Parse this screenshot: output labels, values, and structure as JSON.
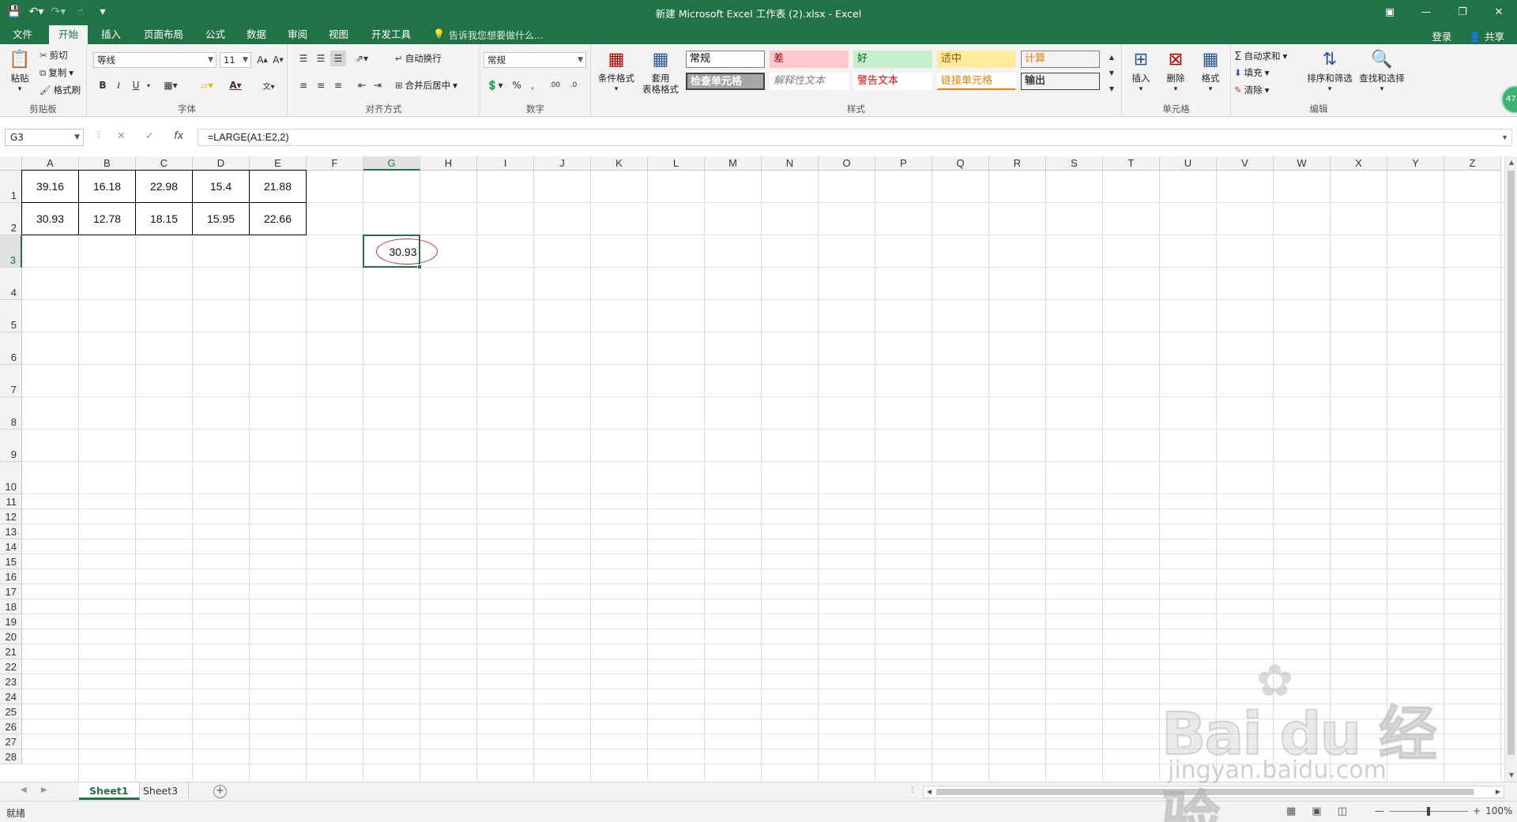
{
  "window": {
    "title": "新建 Microsoft Excel 工作表 (2).xlsx - Excel"
  },
  "tabs": [
    "文件",
    "开始",
    "插入",
    "页面布局",
    "公式",
    "数据",
    "审阅",
    "视图",
    "开发工具"
  ],
  "tell_me": "告诉我您想要做什么...",
  "account": {
    "login": "登录",
    "share": "共享"
  },
  "ribbon": {
    "clipboard": {
      "paste": "粘贴",
      "cut": "剪切",
      "copy": "复制",
      "format_painter": "格式刷",
      "label": "剪贴板"
    },
    "font": {
      "name": "等线",
      "size": "11",
      "label": "字体"
    },
    "alignment": {
      "wrap": "自动换行",
      "merge": "合并后居中",
      "label": "对齐方式"
    },
    "number": {
      "format": "常规",
      "label": "数字"
    },
    "styles": {
      "conditional": "条件格式",
      "table_format_1": "套用",
      "table_format_2": "表格格式",
      "cells": [
        {
          "text": "常规",
          "bg": "#ffffff",
          "fg": "#000000",
          "border": "#7f7f7f"
        },
        {
          "text": "差",
          "bg": "#ffc7ce",
          "fg": "#9c0006",
          "border": "#ffc7ce"
        },
        {
          "text": "好",
          "bg": "#c6efce",
          "fg": "#006100",
          "border": "#c6efce"
        },
        {
          "text": "适中",
          "bg": "#ffeb9c",
          "fg": "#9c5700",
          "border": "#ffeb9c"
        },
        {
          "text": "计算",
          "bg": "#f2f2f2",
          "fg": "#fa7d00",
          "border": "#7f7f7f"
        },
        {
          "text": "检查单元格",
          "bg": "#a5a5a5",
          "fg": "#ffffff",
          "border": "#3f3f3f"
        },
        {
          "text": "解释性文本",
          "bg": "#ffffff",
          "fg": "#7f7f7f",
          "border": "#ffffff"
        },
        {
          "text": "警告文本",
          "bg": "#ffffff",
          "fg": "#ff0000",
          "border": "#ffffff"
        },
        {
          "text": "链接单元格",
          "bg": "#ffffff",
          "fg": "#fa7d00",
          "border": "#ffffff"
        },
        {
          "text": "输出",
          "bg": "#f2f2f2",
          "fg": "#3f3f3f",
          "border": "#3f3f3f"
        }
      ],
      "label": "样式"
    },
    "cells": {
      "insert": "插入",
      "delete": "删除",
      "format": "格式",
      "label": "单元格"
    },
    "editing": {
      "autosum": "自动求和",
      "fill": "填充",
      "clear": "清除",
      "sort": "排序和筛选",
      "find": "查找和选择",
      "label": "编辑"
    }
  },
  "formula_bar": {
    "name_box": "G3",
    "formula": "=LARGE(A1:E2,2)",
    "fx": "fx"
  },
  "grid": {
    "columns": [
      "A",
      "B",
      "C",
      "D",
      "E",
      "F",
      "G",
      "H",
      "I",
      "J",
      "K",
      "L",
      "M",
      "N",
      "O",
      "P",
      "Q",
      "R",
      "S",
      "T",
      "U",
      "V",
      "W",
      "X",
      "Y",
      "Z"
    ],
    "rows": [
      "1",
      "2",
      "3",
      "4",
      "5",
      "6",
      "7",
      "8",
      "9",
      "10",
      "11",
      "12",
      "13",
      "14",
      "15",
      "16",
      "17",
      "18",
      "19",
      "20",
      "21",
      "22",
      "23",
      "24",
      "25",
      "26",
      "27",
      "28"
    ],
    "selected_col": "G",
    "selected_row": "3",
    "data": [
      [
        "39.16",
        "16.18",
        "22.98",
        "15.4",
        "21.88"
      ],
      [
        "30.93",
        "12.78",
        "18.15",
        "15.95",
        "22.66"
      ]
    ],
    "result": "30.93"
  },
  "sheets": [
    "Sheet1",
    "Sheet3"
  ],
  "active_sheet": "Sheet1",
  "status": {
    "ready": "就绪",
    "zoom": "100%"
  },
  "watermark": {
    "brand": "Bai du 经验",
    "url": "jingyan.baidu.com"
  },
  "badge": "47",
  "colors": {
    "accent": "#217346",
    "annotation": "#d32f2f"
  }
}
